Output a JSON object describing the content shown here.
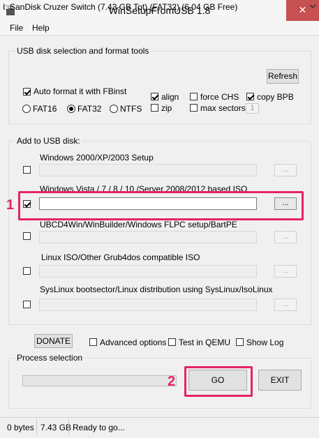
{
  "window": {
    "title": "WinSetupFromUSB 1.8",
    "close_glyph": "✕"
  },
  "menu": [
    "File",
    "Help"
  ],
  "usb_group": {
    "title": "USB disk selection and format tools",
    "drive_selected": "I: SanDisk Cruzer Switch (7.43 GB Tot) (FAT32) (6.04 GB Free)",
    "refresh_label": "Refresh",
    "auto_format": {
      "label": "Auto format it with FBinst",
      "checked": true
    },
    "filesystems": [
      {
        "label": "FAT16",
        "checked": false
      },
      {
        "label": "FAT32",
        "checked": true
      },
      {
        "label": "NTFS",
        "checked": false
      }
    ],
    "options": {
      "align": {
        "label": "align",
        "checked": true
      },
      "zip": {
        "label": "zip",
        "checked": false
      },
      "force_chs": {
        "label": "force CHS",
        "checked": false
      },
      "max_sectors": {
        "label": "max sectors",
        "checked": false
      },
      "copy_bpb": {
        "label": "copy BPB",
        "checked": true
      }
    },
    "spin_value": "1"
  },
  "add_group": {
    "title": "Add to USB disk:",
    "browse_label": "...",
    "rows": [
      {
        "label": "Windows 2000/XP/2003 Setup",
        "checked": false,
        "enabled": false,
        "value": ""
      },
      {
        "label": "Windows Vista / 7 / 8 / 10 /Server 2008/2012 based ISO",
        "checked": true,
        "enabled": true,
        "value": ""
      },
      {
        "label": "UBCD4Win/WinBuilder/Windows FLPC setup/BartPE",
        "checked": false,
        "enabled": false,
        "value": ""
      },
      {
        "label": "Linux ISO/Other Grub4dos compatible ISO",
        "checked": false,
        "enabled": false,
        "value": ""
      },
      {
        "label": "SysLinux bootsector/Linux distribution using SysLinux/IsoLinux",
        "checked": false,
        "enabled": false,
        "value": ""
      }
    ]
  },
  "bottom_options": {
    "donate_label": "DONATE",
    "advanced_options": {
      "label": "Advanced options",
      "checked": false
    },
    "test_qemu": {
      "label": "Test in QEMU",
      "checked": false
    },
    "show_log": {
      "label": "Show Log",
      "checked": false
    }
  },
  "process": {
    "title": "Process selection",
    "progress": 0,
    "go_label": "GO",
    "exit_label": "EXIT"
  },
  "annotations": {
    "badge_1": "1",
    "badge_2": "2",
    "color": "#e5226a"
  },
  "status": {
    "bytes": "0 bytes",
    "size": "7.43 GB",
    "message": "Ready to go..."
  }
}
